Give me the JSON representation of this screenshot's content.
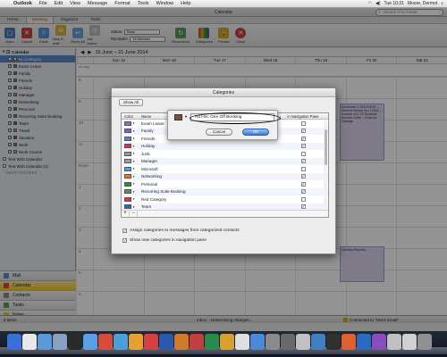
{
  "menubar": {
    "apple": "",
    "items": [
      "Outlook",
      "File",
      "Edit",
      "View",
      "Message",
      "Format",
      "Tools",
      "Window",
      "Help"
    ],
    "clock": "Tue 10:31",
    "user": "Moore, Dermot"
  },
  "window": {
    "title": "Calendar",
    "search_placeholder": "Search This Folder"
  },
  "ribbon": {
    "tabs": [
      "Home",
      "Meeting",
      "Organize",
      "Tools"
    ],
    "active_tab": "Meeting",
    "buttons": [
      "Open",
      "Cancel",
      "Invite",
      "New E-mail",
      "Reply All",
      "Join Online",
      "Recurrence",
      "Categorize",
      "Private",
      "Close"
    ],
    "status_label": "Status:",
    "status_value": "Busy",
    "reminder_label": "Reminder:",
    "reminder_value": "15 Minutes"
  },
  "sidebar": {
    "calendar_label": "Calendar",
    "categories": [
      {
        "name": "No Category",
        "color": "#ffffff",
        "selected": true
      },
      {
        "name": "Exam Leave",
        "color": "#b05ad1"
      },
      {
        "name": "Family",
        "color": "#7d5ad6"
      },
      {
        "name": "Friends",
        "color": "#5b7fd4"
      },
      {
        "name": "Holiday",
        "color": "#c93a3a"
      },
      {
        "name": "Manager",
        "color": "#9a9a9a"
      },
      {
        "name": "Networking",
        "color": "#e07b2b"
      },
      {
        "name": "Personal",
        "color": "#2f8a3a"
      },
      {
        "name": "Recurring Suite Booking",
        "color": "#5b8f3a"
      },
      {
        "name": "Team",
        "color": "#3a5fb0"
      },
      {
        "name": "Travel",
        "color": "#d4a52b"
      },
      {
        "name": "Vacation",
        "color": "#8a3a6f"
      },
      {
        "name": "Work",
        "color": "#3a8fa8"
      },
      {
        "name": "Work Course",
        "color": "#d9c22b"
      }
    ],
    "web_calendars": [
      "Test Web Calendar",
      "Test Web Calendar (1)"
    ],
    "smart_folders": "SMART FOLDERS",
    "nav": [
      "Mail",
      "Calendar",
      "Contacts",
      "Tasks",
      "Notes"
    ],
    "nav_active": "Calendar"
  },
  "calendar": {
    "range": "15 June – 21 June 2014",
    "days": [
      "Sun 15",
      "Mon 16",
      "Tue 17",
      "Wed 18",
      "Thu 19",
      "Fri 20",
      "Sat 21"
    ],
    "allday_label": "all-day",
    "hours": [
      "8",
      "9",
      "10",
      "11",
      "Noon",
      "1",
      "2",
      "3",
      "4",
      "5",
      "6"
    ],
    "events": [
      {
        "text": "Semester 1 2014/2015 – Dermot Moore (ex 1234) – Course #11 23  General Access Suite – Áras na Gaeilge"
      },
      {
        "text": "Weekly Reports"
      }
    ]
  },
  "statusbar": {
    "items": "8 items",
    "inbox_status": "Inbox – Determining changes...",
    "connection": "Connected to \"NUIG Email\""
  },
  "dialog": {
    "title": "Categories",
    "show_all": "Show All",
    "col_color": "Color",
    "col_name": "Name",
    "col_nav": "in Navigation Pane",
    "rows": [
      {
        "name": "Exam Leave",
        "color": "#b05ad1",
        "nav": false
      },
      {
        "name": "Family",
        "color": "#7d5ad6",
        "nav": true
      },
      {
        "name": "Friends",
        "color": "#5b7fd4",
        "nav": true
      },
      {
        "name": "Holiday",
        "color": "#c93a3a",
        "nav": true
      },
      {
        "name": "Junk",
        "color": "#9a9a9a",
        "nav": false
      },
      {
        "name": "Manager",
        "color": "#a0a0a0",
        "nav": true
      },
      {
        "name": "Microsoft",
        "color": "#5b9fd4",
        "nav": false
      },
      {
        "name": "Networking",
        "color": "#e07b2b",
        "nav": true
      },
      {
        "name": "Personal",
        "color": "#2f8a3a",
        "nav": true
      },
      {
        "name": "Recurring Suite Booking",
        "color": "#5b8f3a",
        "nav": true
      },
      {
        "name": "Red Category",
        "color": "#d43a3a",
        "nav": false
      },
      {
        "name": "Team",
        "color": "#3a5fb0",
        "nav": true
      }
    ],
    "opt_assign": "Assign categories to messages from categorized contacts",
    "opt_show": "Show new categories in navigation pane"
  },
  "popover": {
    "value": "Ad Hoc One Off Booking",
    "swatch_color": "#8b4a2b",
    "cancel": "Cancel",
    "ok": "OK"
  }
}
